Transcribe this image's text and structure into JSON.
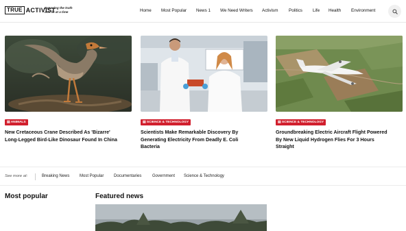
{
  "brand": {
    "logo_true": "TRUE",
    "logo_activist": "ACTIVIST",
    "tagline": "Exposing the truth one lie at a time"
  },
  "nav": {
    "items": [
      "Home",
      "Most Popular",
      "News 1",
      "We Need Writers",
      "Activism",
      "Politics",
      "Life",
      "Health",
      "Environment"
    ]
  },
  "icons": {
    "search": "search-icon",
    "tag": "folder-icon"
  },
  "colors": {
    "accent": "#d11f2d"
  },
  "articles": [
    {
      "category": "ANIMALS",
      "title_lines": [
        "New Cretaceous Crane Described As 'Bizarre'",
        "Long-Legged Bird-Like Dinosaur Found In China"
      ]
    },
    {
      "category": "SCIENCE & TECHNOLOGY",
      "title_lines": [
        "Scientists Make Remarkable Discovery By",
        "Generating Electricity From Deadly E. Coli",
        "Bacteria"
      ]
    },
    {
      "category": "SCIENCE & TECHNOLOGY",
      "title_lines": [
        "Groundbreaking Electric Aircraft Flight Powered",
        "By New Liquid Hydrogen Flies For 3 Hours",
        "Straight"
      ]
    }
  ],
  "see_more": {
    "label": "See more at:",
    "items": [
      "Breaking News",
      "Most Popular",
      "Documentaries",
      "Government",
      "Science & Technology"
    ]
  },
  "sections": {
    "most_popular": "Most popular",
    "featured_news": "Featured news"
  }
}
